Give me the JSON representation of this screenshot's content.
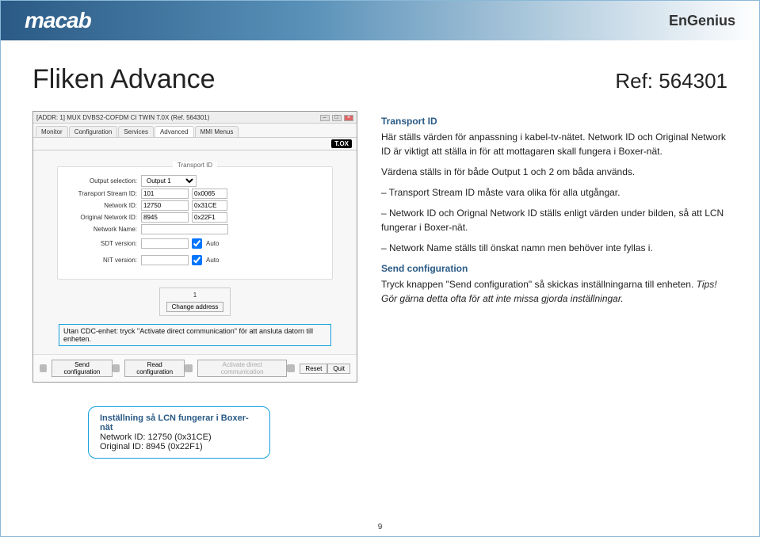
{
  "header": {
    "logo_left": "macab",
    "logo_right": "EnGenius"
  },
  "title": "Fliken Advance",
  "ref": "Ref: 564301",
  "window": {
    "title": "[ADDR: 1] MUX DVBS2-COFDM CI TWIN T.0X (Ref. 564301)",
    "badge": "T.OX",
    "tabs": [
      "Monitor",
      "Configuration",
      "Services",
      "Advanced",
      "MMI Menus"
    ],
    "active_tab": "Advanced",
    "panel_title": "Transport ID",
    "form": {
      "output_select_label": "Output selection:",
      "output_select_value": "Output 1",
      "ts_id_label": "Transport Stream ID:",
      "ts_id_value": "101",
      "ts_id_hex": "0x0065",
      "net_id_label": "Network ID:",
      "net_id_value": "12750",
      "net_id_hex": "0x31CE",
      "orig_id_label": "Original Network ID:",
      "orig_id_value": "8945",
      "orig_id_hex": "0x22F1",
      "net_name_label": "Network Name:",
      "net_name_value": "",
      "sdt_label": "SDT version:",
      "sdt_auto": "Auto",
      "nit_label": "NIT version:",
      "nit_auto": "Auto"
    },
    "change_address": {
      "value": "1",
      "button": "Change address"
    },
    "note": "Utan CDC-enhet: tryck \"Activate direct communication\" för att ansluta datorn till enheten.",
    "buttons": {
      "send": "Send configuration",
      "read": "Read configuration",
      "activate": "Activate direct communication",
      "reset": "Reset",
      "quit": "Quit"
    }
  },
  "right": {
    "t1_title": "Transport ID",
    "t1_p1": "Här ställs värden för anpassning i kabel-tv-nätet. Network ID och Original Network ID är viktigt att ställa in för att mottagaren skall fungera i Boxer-nät.",
    "t1_p2": "Värdena ställs in för både Output 1 och 2 om båda används.",
    "t1_l1": "– Transport Stream ID måste vara olika för alla utgångar.",
    "t1_l2": "– Network ID och Orignal Network ID ställs enligt värden under bilden, så att LCN fungerar i Boxer-nät.",
    "t1_l3": "– Network Name ställs till önskat namn men behöver inte fyllas i.",
    "t2_title": "Send configuration",
    "t2_p1a": "Tryck knappen \"Send configuration\" så skickas inställningarna till enheten. ",
    "t2_p1b": "Tips!",
    "t2_p1c": " Gör gärna detta ofta för att inte missa gjorda inställningar."
  },
  "tip": {
    "title": "Inställning så LCN fungerar i Boxer-nät",
    "l1": "Network ID: 12750 (0x31CE)",
    "l2": "Original ID: 8945 (0x22F1)"
  },
  "page": "9"
}
